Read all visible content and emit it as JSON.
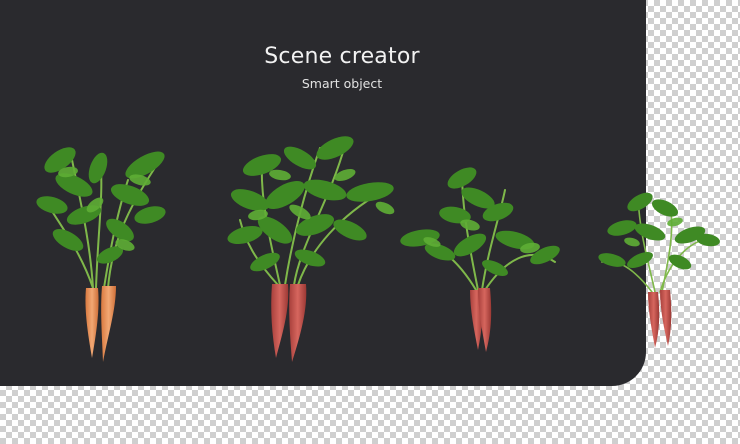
{
  "header": {
    "title": "Scene creator",
    "subtitle": "Smart object"
  },
  "colors": {
    "panel_background": "#2a2a2e",
    "checker_light": "#ffffff",
    "checker_dark": "#cfcfcf",
    "leaf_green": "#4f9a2c",
    "orange_carrot": "#e8955a",
    "red_carrot": "#c9554e"
  },
  "scene": {
    "objects": [
      {
        "kind": "carrot-pair",
        "variety": "orange"
      },
      {
        "kind": "carrot-pair",
        "variety": "red"
      },
      {
        "kind": "carrot-pair",
        "variety": "red"
      },
      {
        "kind": "carrot-pair",
        "variety": "red"
      }
    ]
  }
}
